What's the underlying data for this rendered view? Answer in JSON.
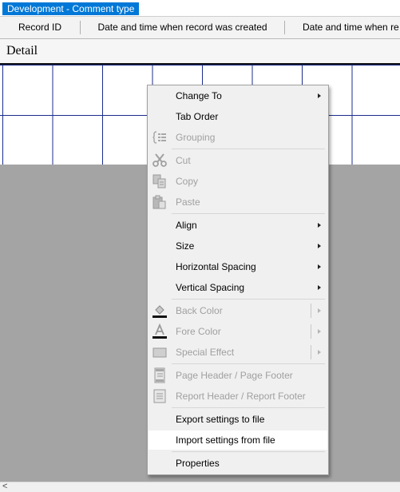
{
  "window": {
    "tab_title": "Development - Comment type"
  },
  "columns": [
    "Record ID",
    "Date and time when record was created",
    "Date and time when re"
  ],
  "section": {
    "label": "Detail"
  },
  "menu": {
    "change_to": "Change To",
    "tab_order": "Tab Order",
    "grouping": "Grouping",
    "cut": "Cut",
    "copy": "Copy",
    "paste": "Paste",
    "align": "Align",
    "size": "Size",
    "horizontal_spacing": "Horizontal Spacing",
    "vertical_spacing": "Vertical Spacing",
    "back_color": "Back Color",
    "fore_color": "Fore Color",
    "special_effect": "Special Effect",
    "page_header_footer": "Page Header / Page Footer",
    "report_header_footer": "Report Header / Report Footer",
    "export_settings": "Export settings to file",
    "import_settings": "Import settings from file",
    "properties": "Properties"
  },
  "icons": {
    "grouping": "grouping-icon",
    "cut": "scissors-icon",
    "copy": "copy-icon",
    "paste": "clipboard-icon",
    "back_color": "paint-bucket-icon",
    "fore_color": "font-color-icon",
    "special_effect": "special-effect-icon",
    "page_header_footer": "page-header-icon",
    "report_header_footer": "report-header-icon"
  },
  "colors": {
    "accent": "#0078d7",
    "grid_lines": "#1c2d8c",
    "menu_background": "#f0f0f0",
    "highlight": "#ffffff",
    "disabled_text": "#a0a0a0",
    "workspace": "#a4a4a4"
  }
}
